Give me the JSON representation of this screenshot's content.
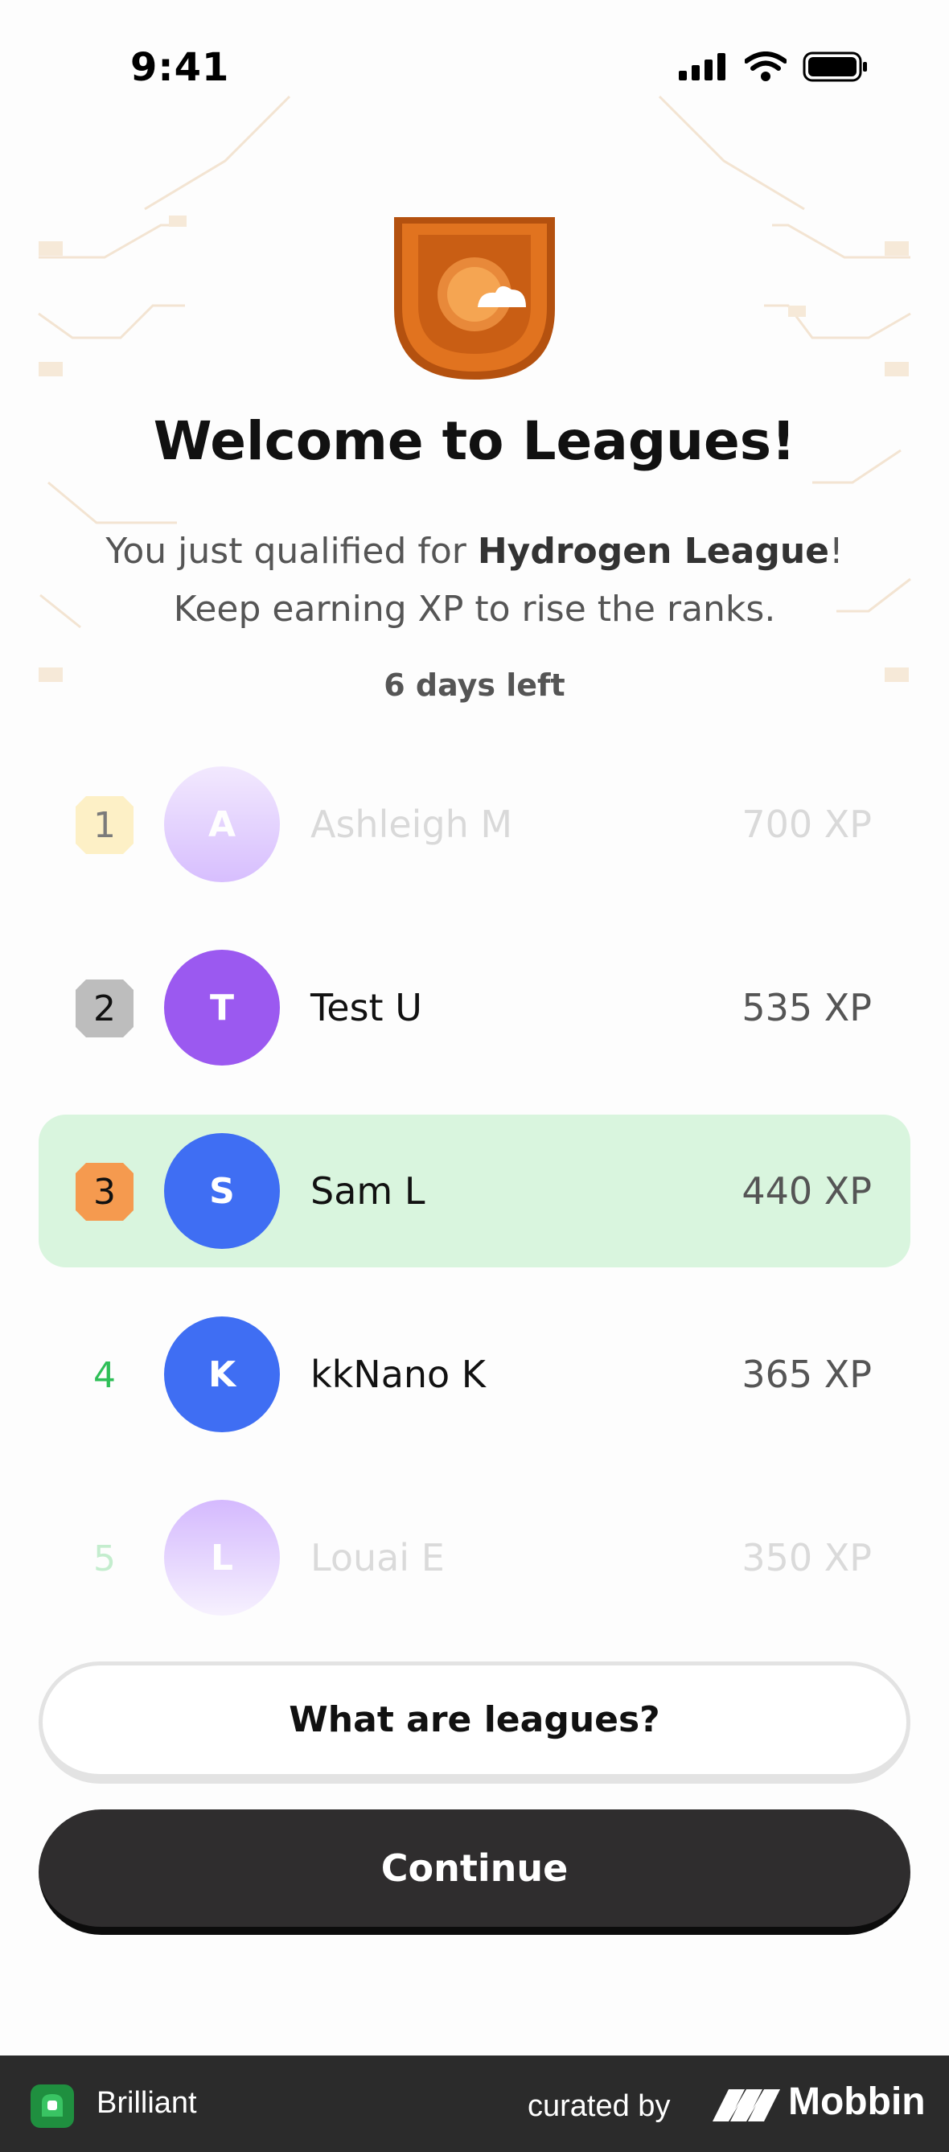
{
  "status_bar": {
    "time": "9:41"
  },
  "header": {
    "title": "Welcome to Leagues!",
    "subtitle_prefix": "You just qualified for ",
    "league_name": "Hydrogen League",
    "subtitle_suffix": "!",
    "subtitle_line2": "Keep earning XP to rise the ranks.",
    "days_left": "6 days left"
  },
  "leaderboard": [
    {
      "rank": "1",
      "initial": "A",
      "name": "Ashleigh M",
      "xp": "700 XP",
      "avatar_color": "#b98cff",
      "chip_color": "#fde79a"
    },
    {
      "rank": "2",
      "initial": "T",
      "name": "Test U",
      "xp": "535 XP",
      "avatar_color": "#9b59f0",
      "chip_color": "#bdbdbd"
    },
    {
      "rank": "3",
      "initial": "S",
      "name": "Sam L",
      "xp": "440 XP",
      "avatar_color": "#3f6ef3",
      "chip_color": "#f59a4f",
      "highlight_color": "#d9f5de"
    },
    {
      "rank": "4",
      "initial": "K",
      "name": "kkNano K",
      "xp": "365 XP",
      "avatar_color": "#3f6ef3",
      "rank_color": "#2fbf58"
    },
    {
      "rank": "5",
      "initial": "L",
      "name": "Louai E",
      "xp": "350 XP",
      "avatar_color": "#b98cff",
      "rank_color": "#9fe3b0"
    }
  ],
  "buttons": {
    "what_are_leagues": "What are leagues?",
    "continue": "Continue"
  },
  "footer": {
    "app_name": "Brilliant",
    "curated_by": "curated by",
    "brand": "Mobbin"
  }
}
